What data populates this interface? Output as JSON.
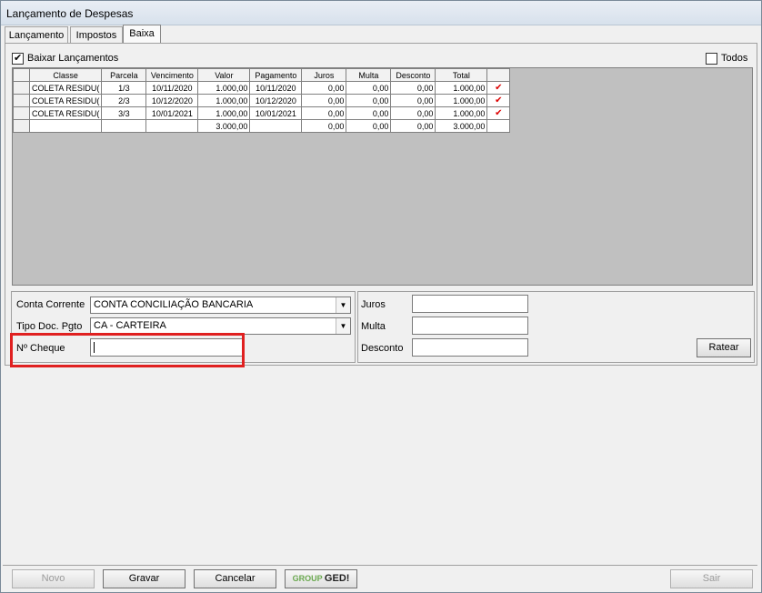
{
  "window": {
    "title": "Lançamento de Despesas"
  },
  "tabs": [
    {
      "label": "Lançamento"
    },
    {
      "label": "Impostos"
    },
    {
      "label": "Baixa"
    }
  ],
  "baixa": {
    "baixar_label": "Baixar Lançamentos",
    "baixar_checked": true,
    "todos_label": "Todos",
    "todos_checked": false
  },
  "grid": {
    "columns": [
      "Classe",
      "Parcela",
      "Vencimento",
      "Valor",
      "Pagamento",
      "Juros",
      "Multa",
      "Desconto",
      "Total"
    ],
    "rows": [
      [
        "COLETA RESIDU(",
        "1/3",
        "10/11/2020",
        "1.000,00",
        "10/11/2020",
        "0,00",
        "0,00",
        "0,00",
        "1.000,00"
      ],
      [
        "COLETA RESIDU(",
        "2/3",
        "10/12/2020",
        "1.000,00",
        "10/12/2020",
        "0,00",
        "0,00",
        "0,00",
        "1.000,00"
      ],
      [
        "COLETA RESIDU(",
        "3/3",
        "10/01/2021",
        "1.000,00",
        "10/01/2021",
        "0,00",
        "0,00",
        "0,00",
        "1.000,00"
      ]
    ],
    "totals": [
      "",
      "",
      "",
      "3.000,00",
      "",
      "0,00",
      "0,00",
      "0,00",
      "3.000,00"
    ]
  },
  "form": {
    "conta_corrente_label": "Conta Corrente",
    "conta_corrente_value": "CONTA CONCILIAÇÃO BANCARIA",
    "tipo_doc_label": "Tipo Doc. Pgto",
    "tipo_doc_value": "CA - CARTEIRA",
    "cheque_label": "Nº Cheque",
    "cheque_value": "",
    "juros_label": "Juros",
    "multa_label": "Multa",
    "desconto_label": "Desconto",
    "ratear_label": "Ratear"
  },
  "footer": {
    "novo": "Novo",
    "gravar": "Gravar",
    "cancelar": "Cancelar",
    "ged_group": "GROUP",
    "ged_name": "GED!",
    "sair": "Sair"
  },
  "colors": {
    "highlight": "#e02020",
    "check_mark": "#d00000"
  }
}
